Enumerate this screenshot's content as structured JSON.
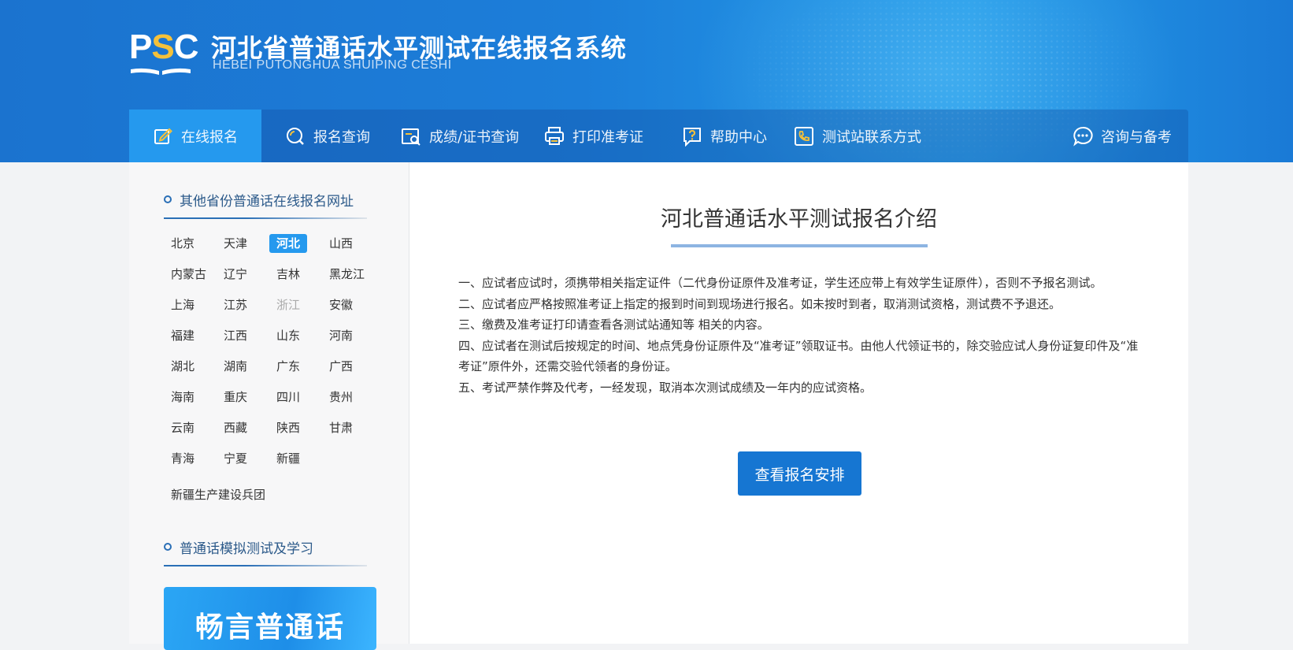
{
  "header": {
    "logo_text": "PSC",
    "title": "河北省普通话水平测试在线报名系统",
    "subtitle": "HEBEI PUTONGHUA SHUIPING CESHI"
  },
  "nav": {
    "items": [
      {
        "label": "在线报名",
        "icon": "edit-icon",
        "active": true
      },
      {
        "label": "报名查询",
        "icon": "search-icon"
      },
      {
        "label": "成绩/证书查询",
        "icon": "certificate-search-icon"
      },
      {
        "label": "打印准考证",
        "icon": "printer-icon"
      },
      {
        "label": "帮助中心",
        "icon": "help-icon"
      },
      {
        "label": "测试站联系方式",
        "icon": "phone-icon"
      },
      {
        "label": "咨询与备考",
        "icon": "chat-icon"
      }
    ]
  },
  "sidebar": {
    "provinces_title": "其他省份普通话在线报名网址",
    "provinces": [
      "北京",
      "天津",
      "河北",
      "山西",
      "内蒙古",
      "辽宁",
      "吉林",
      "黑龙江",
      "上海",
      "江苏",
      "浙江",
      "安徽",
      "福建",
      "江西",
      "山东",
      "河南",
      "湖北",
      "湖南",
      "广东",
      "广西",
      "海南",
      "重庆",
      "四川",
      "贵州",
      "云南",
      "西藏",
      "陕西",
      "甘肃",
      "青海",
      "宁夏",
      "新疆"
    ],
    "active_province": "河北",
    "disabled_province": "浙江",
    "extra_item": "新疆生产建设兵团",
    "study_title": "普通话模拟测试及学习",
    "banner_text": "畅言普通话"
  },
  "main": {
    "title": "河北普通话水平测试报名介绍",
    "rules": [
      "一、应试者应试时，须携带相关指定证件（二代身份证原件及准考证，学生还应带上有效学生证原件），否则不予报名测试。",
      "二、应试者应严格按照准考证上指定的报到时间到现场进行报名。如未按时到者，取消测试资格，测试费不予退还。",
      "三、缴费及准考证打印请查看各测试站通知等 相关的内容。",
      "四、应试者在测试后按规定的时间、地点凭身份证原件及“准考证”领取证书。由他人代领证书的，除交验应试人身份证复印件及“准考证”原件外，还需交验代领者的身份证。",
      "五、考试严禁作弊及代考，一经发现，取消本次测试成绩及一年内的应试资格。"
    ],
    "button_label": "查看报名安排"
  },
  "colors": {
    "header_blue": "#1c7ed9",
    "nav_active": "#2599ee",
    "button_blue": "#1676d2",
    "logo_yellow": "#f5c13a"
  }
}
